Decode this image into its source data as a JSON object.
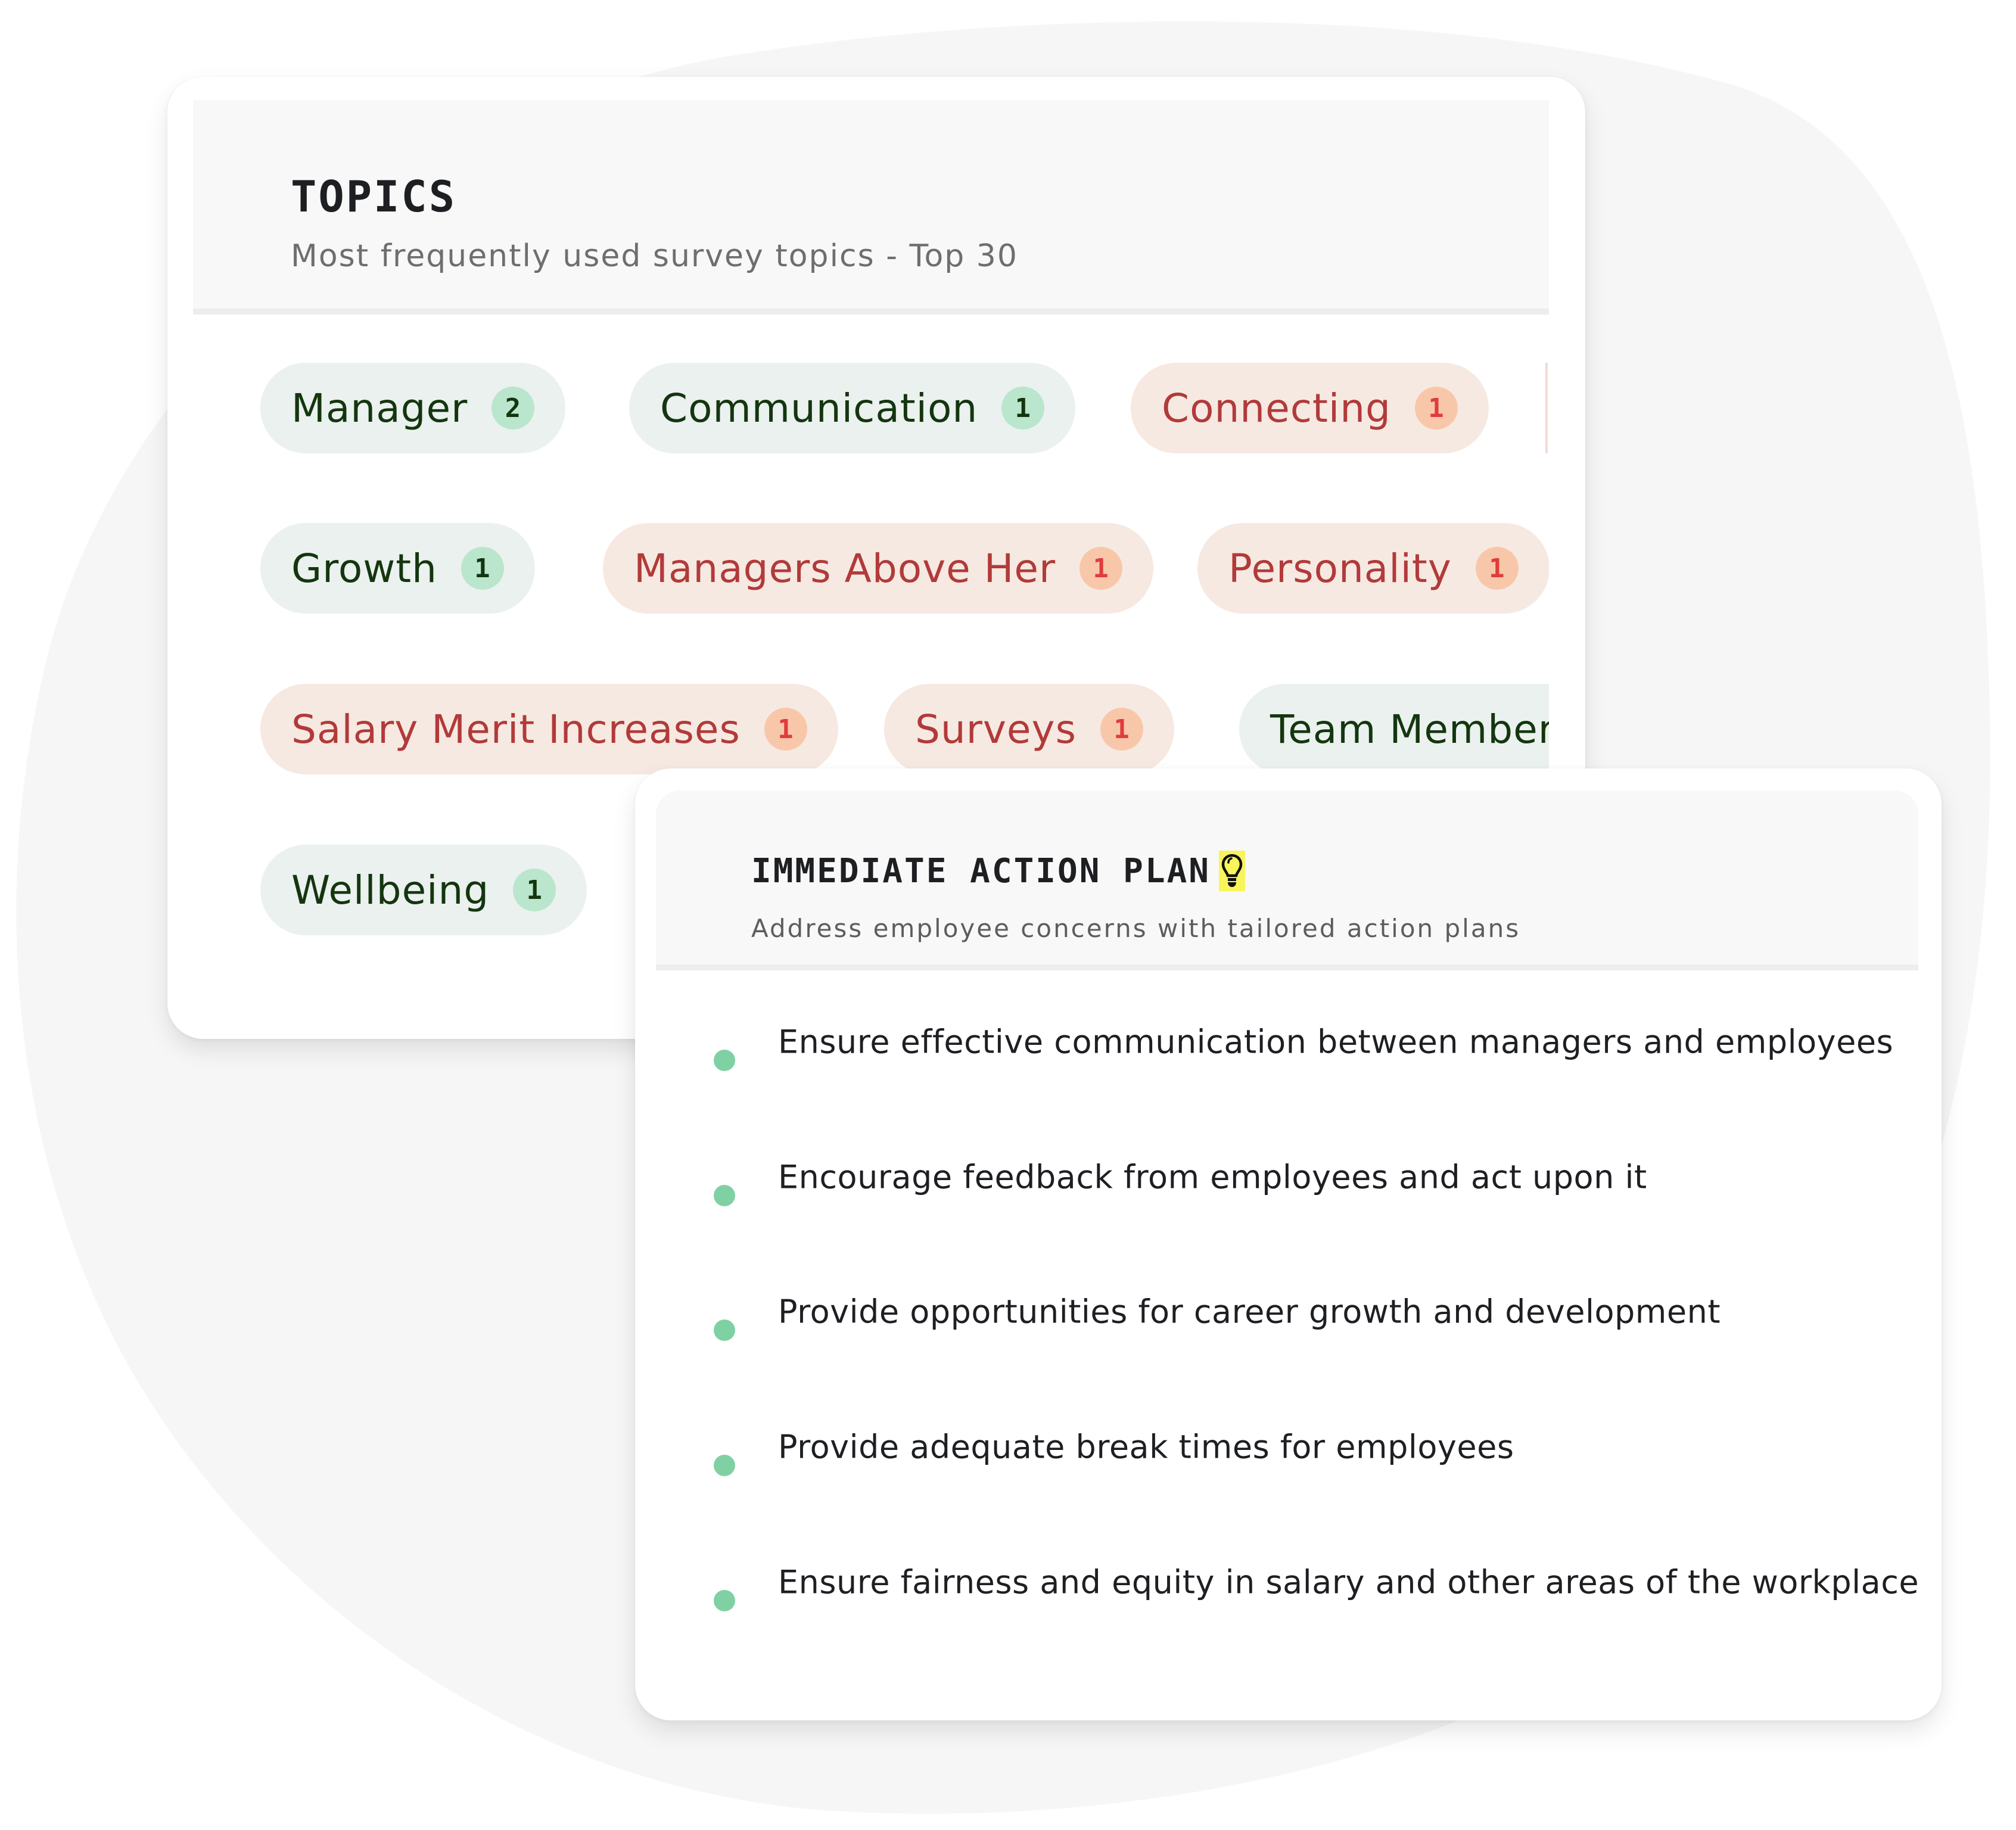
{
  "topics_card": {
    "title": "TOPICS",
    "subtitle": "Most frequently used survey topics - Top 30",
    "rows": [
      [
        {
          "label": "Manager",
          "count": "2",
          "sentiment": "positive"
        },
        {
          "label": "Communication",
          "count": "1",
          "sentiment": "positive"
        },
        {
          "label": "Connecting",
          "count": "1",
          "sentiment": "negative"
        },
        {
          "label": "",
          "count": "",
          "sentiment": "negative",
          "clipped": true
        }
      ],
      [
        {
          "label": "Growth",
          "count": "1",
          "sentiment": "positive"
        },
        {
          "label": "Managers Above Her",
          "count": "1",
          "sentiment": "negative"
        },
        {
          "label": "Personality",
          "count": "1",
          "sentiment": "negative"
        }
      ],
      [
        {
          "label": "Salary Merit Increases",
          "count": "1",
          "sentiment": "negative"
        },
        {
          "label": "Surveys",
          "count": "1",
          "sentiment": "negative"
        },
        {
          "label": "Team Members",
          "count": "",
          "sentiment": "positive",
          "clipped": true
        }
      ],
      [
        {
          "label": "Wellbeing",
          "count": "1",
          "sentiment": "positive"
        }
      ]
    ]
  },
  "action_card": {
    "title": "IMMEDIATE ACTION PLAN",
    "title_icon": "lightbulb-icon",
    "subtitle": "Address employee concerns with tailored action plans",
    "items": [
      "Ensure effective communication between managers and employees",
      "Encourage feedback from employees and act upon it",
      "Provide opportunities for career growth and development",
      "Provide adequate break times for employees",
      "Ensure fairness and equity in salary and other areas of the workplace"
    ]
  },
  "colors": {
    "positive_pill_bg": "#ebf1ef",
    "positive_pill_text": "#14360f",
    "positive_count_bg": "#b9e6cc",
    "negative_pill_bg": "#f6e9e1",
    "negative_pill_text": "#b23a3a",
    "negative_count_bg": "#f8c7aa",
    "negative_count_text": "#e03c3c",
    "bullet": "#7fd1a4",
    "bulb_highlight": "#f8f55a"
  }
}
